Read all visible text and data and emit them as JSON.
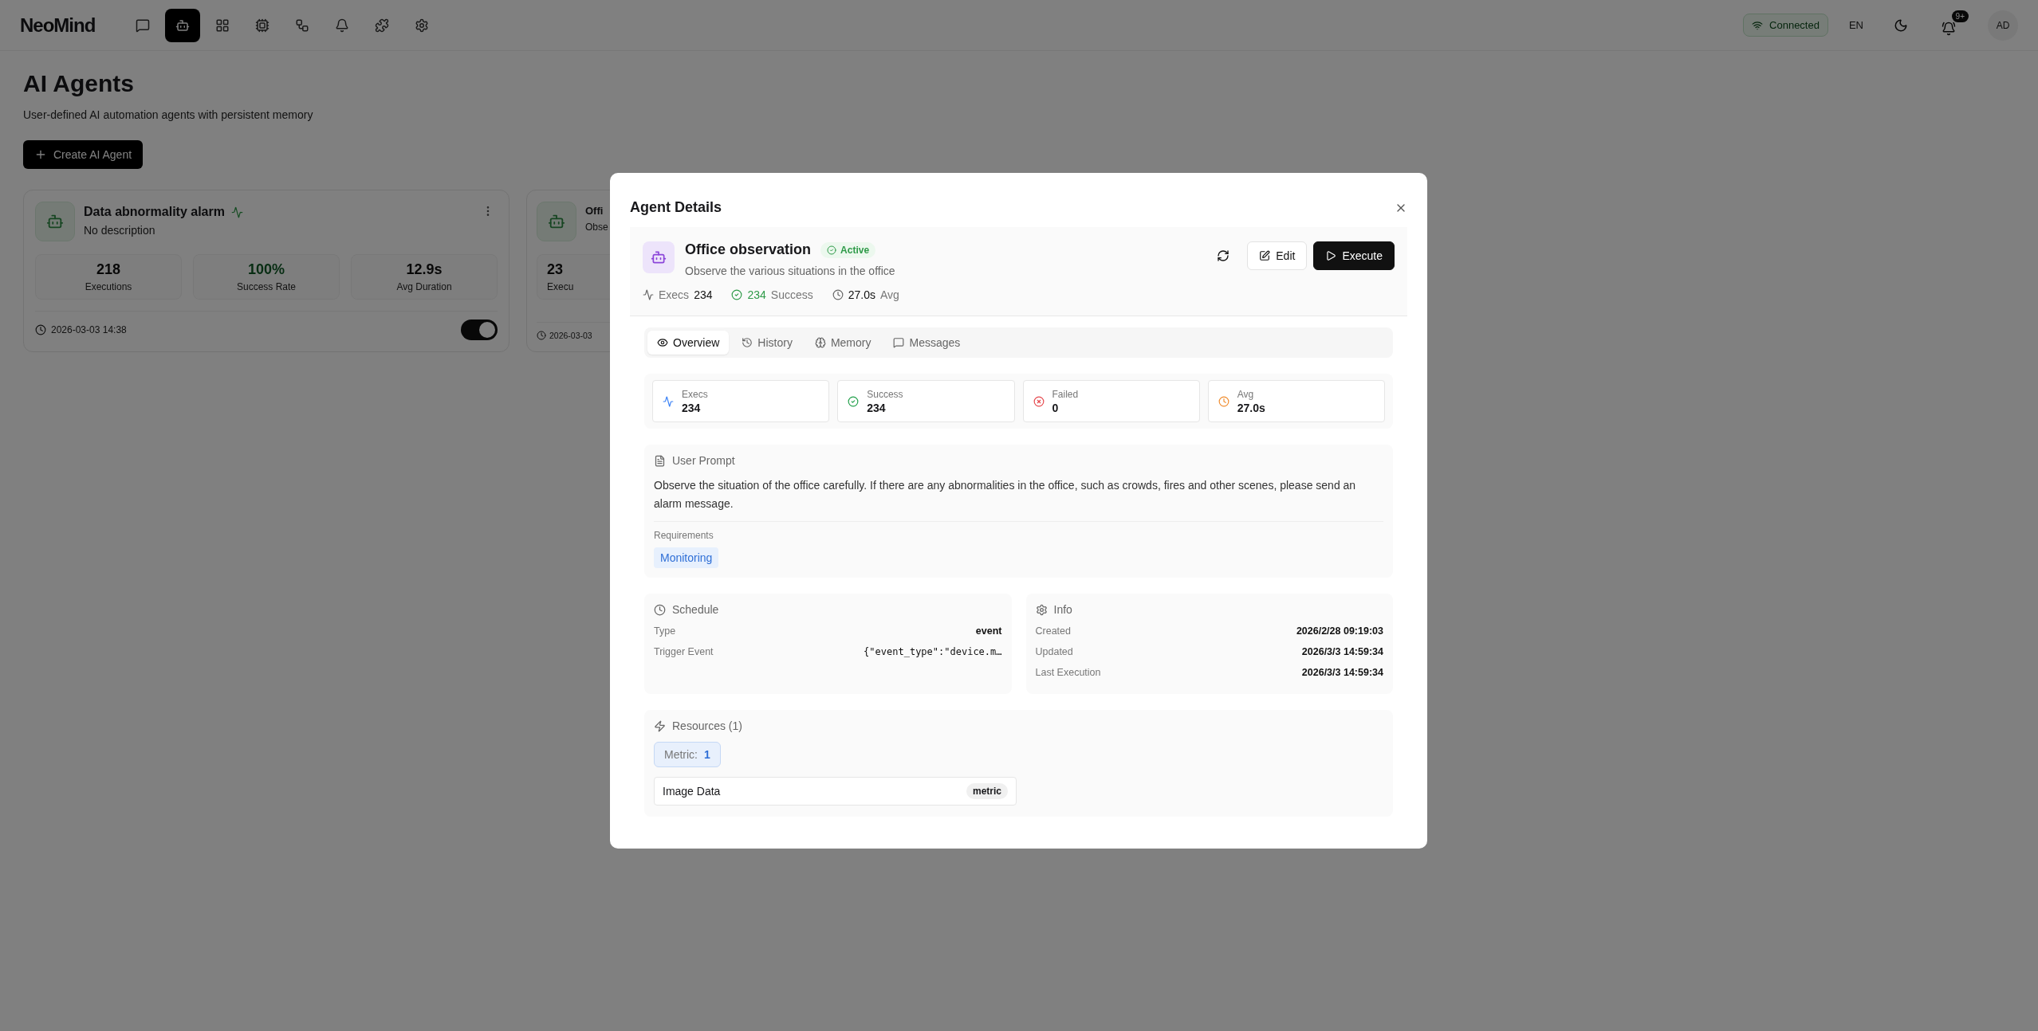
{
  "topbar": {
    "logo": [
      "Ne",
      "o",
      "Mind"
    ],
    "nav": [
      {
        "kind": "chat",
        "selected": false
      },
      {
        "kind": "bot",
        "selected": true
      },
      {
        "kind": "grid",
        "selected": false
      },
      {
        "kind": "chip",
        "selected": false
      },
      {
        "kind": "workflow",
        "selected": false
      },
      {
        "kind": "bell",
        "selected": false
      },
      {
        "kind": "puzzle",
        "selected": false
      },
      {
        "kind": "settings",
        "selected": false
      }
    ],
    "connection": "Connected",
    "language": "EN",
    "notification_badge": "9+",
    "avatar": "AD"
  },
  "page": {
    "title": "AI Agents",
    "subtitle": "User-defined AI automation agents with persistent memory",
    "create_button": "Create AI Agent",
    "cards": [
      {
        "name": "Data abnormality alarm",
        "description": "No description",
        "time": "2026-03-03 14:38",
        "enabled": true,
        "stats": [
          {
            "value": "218",
            "label": "Executions",
            "kind": "plain"
          },
          {
            "value": "100%",
            "label": "Success Rate",
            "kind": "success"
          },
          {
            "value": "12.9s",
            "label": "Avg Duration",
            "kind": "plain"
          }
        ]
      },
      {
        "name": "Offi",
        "description": "Obse",
        "time": "2026-03-03",
        "stats": [
          {
            "value": "23",
            "label": "Execu",
            "kind": "plain"
          }
        ]
      }
    ]
  },
  "modal": {
    "title": "Agent Details",
    "agent": {
      "name": "Office observation",
      "status": "Active",
      "description": "Observe the various situations in the office",
      "stats": [
        {
          "kind": "execs",
          "label": "Execs",
          "value": "234"
        },
        {
          "kind": "success",
          "label": "Success",
          "value": "234"
        },
        {
          "kind": "avg",
          "label": "Avg",
          "value": "27.0s"
        }
      ]
    },
    "actions": {
      "edit": "Edit",
      "execute": "Execute"
    },
    "tabs": [
      {
        "kind": "overview",
        "label": "Overview",
        "selected": true
      },
      {
        "kind": "history",
        "label": "History",
        "selected": false
      },
      {
        "kind": "memory",
        "label": "Memory",
        "selected": false
      },
      {
        "kind": "messages",
        "label": "Messages",
        "selected": false
      }
    ],
    "metrics": [
      {
        "kind": "execs",
        "label": "Execs",
        "value": "234"
      },
      {
        "kind": "success",
        "label": "Success",
        "value": "234"
      },
      {
        "kind": "failed",
        "label": "Failed",
        "value": "0"
      },
      {
        "kind": "avg",
        "label": "Avg",
        "value": "27.0s"
      }
    ],
    "prompt": {
      "title": "User Prompt",
      "text": "Observe the situation of the office carefully. If there are any abnormalities in the office, such as crowds, fires and other scenes, please send an alarm message.",
      "requirements_label": "Requirements",
      "requirements": [
        "Monitoring"
      ]
    },
    "schedule": {
      "title": "Schedule",
      "rows": [
        {
          "label": "Type",
          "value": "event",
          "mono": false
        },
        {
          "label": "Trigger Event",
          "value": "{\"event_type\":\"device.m…",
          "mono": true
        }
      ]
    },
    "info": {
      "title": "Info",
      "rows": [
        {
          "label": "Created",
          "value": "2026/2/28 09:19:03"
        },
        {
          "label": "Updated",
          "value": "2026/3/3 14:59:34"
        },
        {
          "label": "Last Execution",
          "value": "2026/3/3 14:59:34"
        }
      ]
    },
    "resources": {
      "title": "Resources (1)",
      "summary_label": "Metric:",
      "summary_count": "1",
      "items": [
        {
          "name": "Image Data",
          "type": "metric"
        }
      ]
    }
  }
}
